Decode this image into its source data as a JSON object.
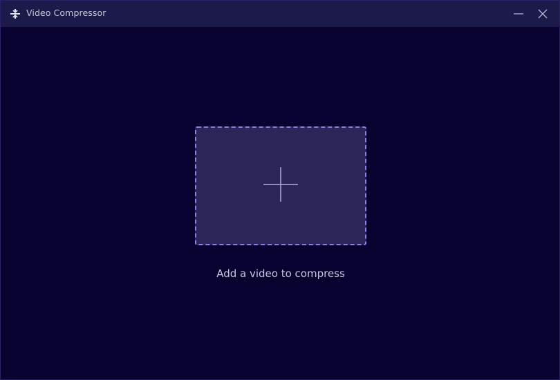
{
  "window": {
    "title": "Video Compressor",
    "app_icon": "compress-icon",
    "controls": {
      "minimize_icon": "minimize-icon",
      "close_icon": "close-icon"
    }
  },
  "main": {
    "add_icon": "plus-icon",
    "add_label": "Add a video to compress"
  },
  "colors": {
    "background": "#070230",
    "titlebar": "#1c1a4b",
    "dropzone_fill": "#2a2758",
    "dropzone_border": "#8f7de8",
    "text": "#c8c6dc"
  }
}
